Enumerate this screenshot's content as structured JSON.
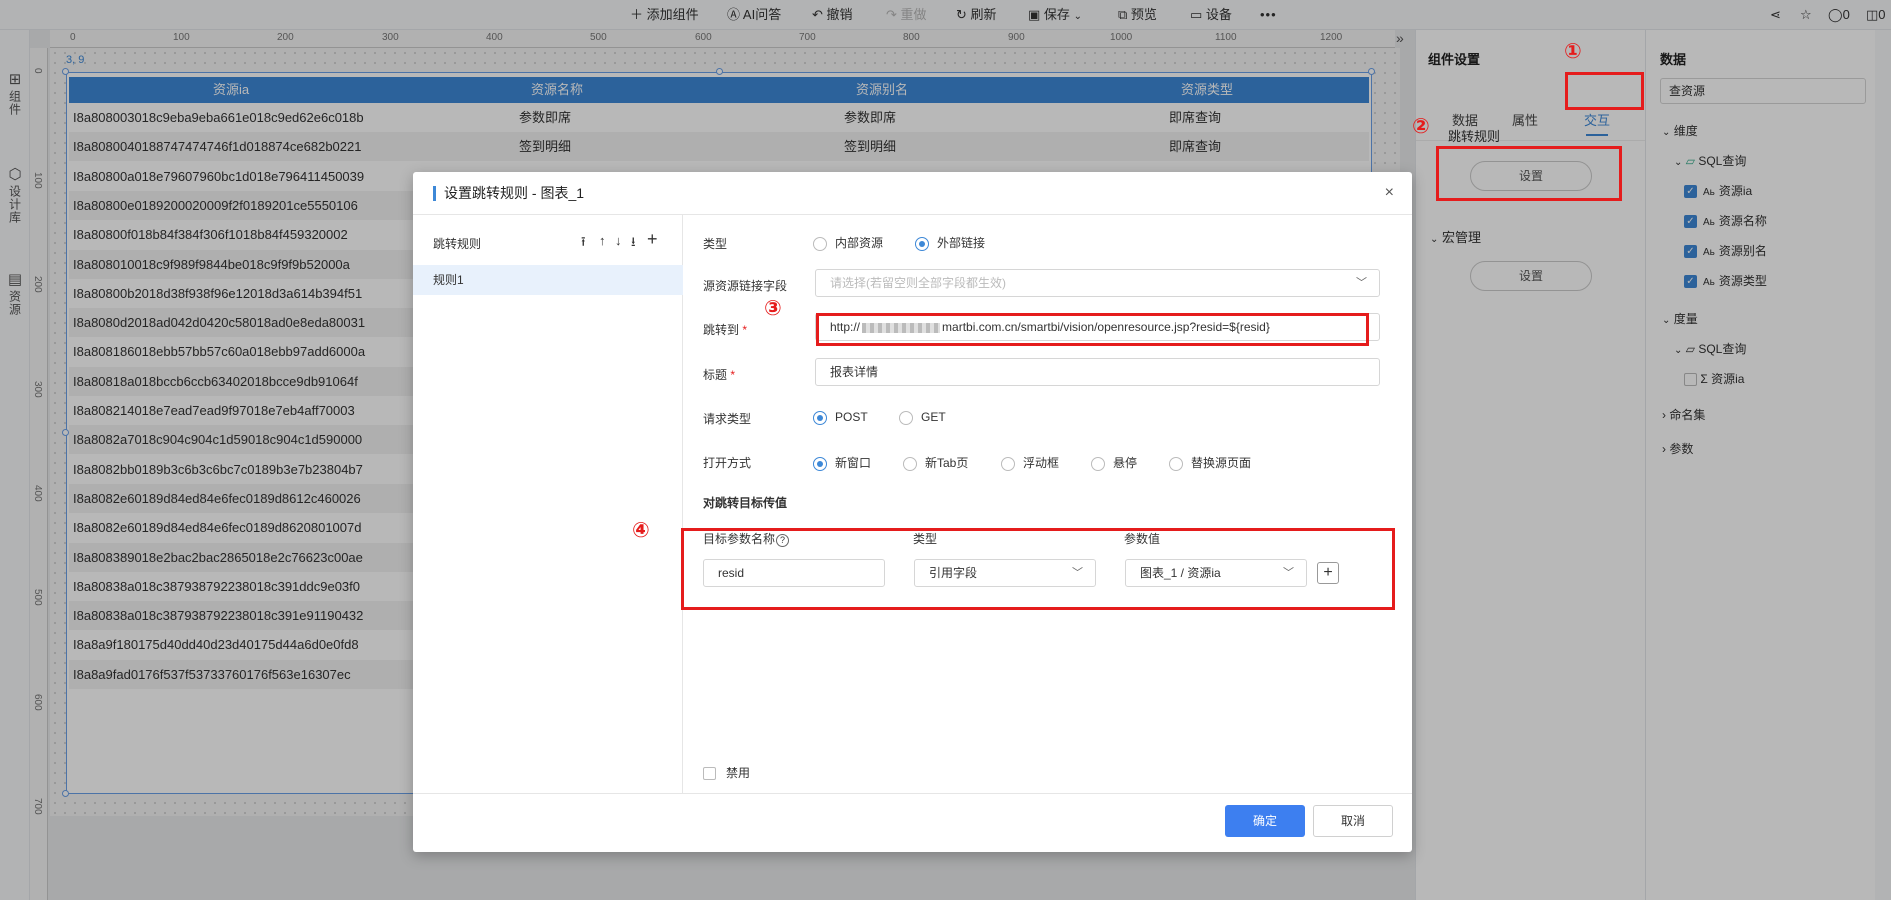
{
  "toolbar": {
    "add_component": "添加组件",
    "ai_qa": "AI问答",
    "undo": "撤销",
    "redo": "重做",
    "refresh": "刷新",
    "save": "保存",
    "preview": "预览",
    "device": "设备",
    "more": "•••",
    "comment_count": "0",
    "right_count": "0"
  },
  "leftbar": {
    "components": "组件",
    "design_lib": "设计库",
    "resources": "资源"
  },
  "rulers": {
    "top": [
      "0",
      "100",
      "200",
      "300",
      "400",
      "500",
      "600",
      "700",
      "800",
      "900",
      "1000",
      "1100",
      "1200"
    ],
    "left": [
      "0",
      "100",
      "200",
      "300",
      "400",
      "500",
      "600",
      "700"
    ]
  },
  "canvas": {
    "coord": "3, 9",
    "collapse_glyph": "»",
    "table": {
      "headers": [
        "资源ia",
        "资源名称",
        "资源别名",
        "资源类型"
      ],
      "rows": [
        [
          "I8a808003018c9eba9eba661e018c9ed62e6c018b",
          "参数即席",
          "参数即席",
          "即席查询"
        ],
        [
          "I8a8080040188747474746f1d018874ce682b0221",
          "签到明细",
          "签到明细",
          "即席查询"
        ],
        [
          "I8a80800a018e79607960bc1d018e796411450039",
          "",
          "",
          ""
        ],
        [
          "I8a80800e0189200020009f2f0189201ce5550106",
          "",
          "",
          ""
        ],
        [
          "I8a80800f018b84f384f306f1018b84f459320002",
          "",
          "",
          ""
        ],
        [
          "I8a808010018c9f989f9844be018c9f9f9b52000a",
          "",
          "",
          ""
        ],
        [
          "I8a80800b2018d38f938f96e12018d3a614b394f51",
          "",
          "",
          ""
        ],
        [
          "I8a8080d2018ad042d0420c58018ad0e8eda80031",
          "",
          "",
          ""
        ],
        [
          "I8a808186018ebb57bb57c60a018ebb97add6000a",
          "",
          "",
          ""
        ],
        [
          "I8a80818a018bccb6ccb63402018bcce9db91064f",
          "",
          "",
          ""
        ],
        [
          "I8a808214018e7ead7ead9f97018e7eb4aff70003",
          "",
          "",
          ""
        ],
        [
          "I8a8082a7018c904c904c1d59018c904c1d590000",
          "",
          "",
          ""
        ],
        [
          "I8a8082bb0189b3c6b3c6bc7c0189b3e7b23804b7",
          "",
          "",
          ""
        ],
        [
          "I8a8082e60189d84ed84e6fec0189d8612c460026",
          "",
          "",
          ""
        ],
        [
          "I8a8082e60189d84ed84e6fec0189d8620801007d",
          "",
          "",
          ""
        ],
        [
          "I8a808389018e2bac2bac2865018e2c76623c00ae",
          "",
          "",
          ""
        ],
        [
          "I8a80838a018c387938792238018c391ddc9e03f0",
          "",
          "",
          ""
        ],
        [
          "I8a80838a018c387938792238018c391e91190432",
          "",
          "",
          ""
        ],
        [
          "I8a8a9f180175d40dd40d23d40175d44a6d0e0fd8",
          "",
          "",
          ""
        ],
        [
          "I8a8a9fad0176f537f53733760176f563e16307ec",
          "",
          "",
          ""
        ]
      ]
    }
  },
  "right_panel": {
    "title": "组件设置",
    "tabs": [
      "数据",
      "属性",
      "交互"
    ],
    "active_tab": "交互",
    "jump_rules": "跳转规则",
    "set_button": "设置",
    "macro": "宏管理",
    "macro_set_button": "设置"
  },
  "data_panel": {
    "title": "数据",
    "dataset": "查资源",
    "dimension": "维度",
    "sql_query": "SQL查询",
    "dimension_fields": [
      "资源ia",
      "资源名称",
      "资源别名",
      "资源类型"
    ],
    "measure": "度量",
    "measure_sql": "SQL查询",
    "measure_fields": [
      "资源ia"
    ],
    "named_sets": "命名集",
    "params": "参数",
    "text_icon": "Aь",
    "sum_icon": "Σ"
  },
  "annotations": {
    "n1": "①",
    "n2": "②",
    "n3": "③",
    "n4": "④",
    "color": "#e51c1c"
  },
  "dialog": {
    "title": "设置跳转规则 - 图表_1",
    "close": "×",
    "rules_header": "跳转规则",
    "rule_tools": [
      "⭱",
      "↑",
      "↓",
      "⭳",
      "+"
    ],
    "rules": [
      "规则1"
    ],
    "type_label": "类型",
    "type_options": [
      "内部资源",
      "外部链接"
    ],
    "type_selected": "外部链接",
    "source_field_label": "源资源链接字段",
    "source_field_placeholder": "请选择(若留空则全部字段都生效)",
    "jump_to_label": "跳转到",
    "url_prefix": "http://",
    "url_suffix": "martbi.com.cn/smartbi/vision/openresource.jsp?resid=${resid}",
    "title_label": "标题",
    "title_value": "报表详情",
    "request_type_label": "请求类型",
    "request_options": [
      "POST",
      "GET"
    ],
    "request_selected": "POST",
    "open_mode_label": "打开方式",
    "open_modes": [
      "新窗口",
      "新Tab页",
      "浮动框",
      "悬停",
      "替换源页面"
    ],
    "open_selected": "新窗口",
    "pass_values_label": "对跳转目标传值",
    "param_header_name": "目标参数名称",
    "param_header_help": "?",
    "param_header_type": "类型",
    "param_header_value": "参数值",
    "param_name": "resid",
    "param_type": "引用字段",
    "param_value": "图表_1 / 资源ia",
    "disable_label": "禁用",
    "ok": "确定",
    "cancel": "取消",
    "accent": "#3d88d7"
  }
}
